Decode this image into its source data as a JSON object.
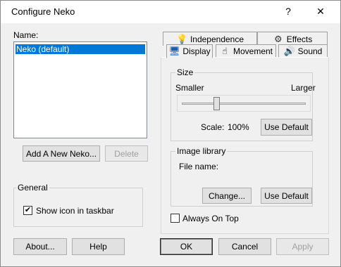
{
  "window": {
    "title": "Configure Neko",
    "help_glyph": "?",
    "close_glyph": "✕"
  },
  "left": {
    "name_label": "Name:",
    "list_items": [
      "Neko (default)"
    ],
    "add_button": "Add A New Neko...",
    "delete_button": "Delete",
    "general_group": "General",
    "show_icon_label": "Show icon in taskbar",
    "show_icon_checked": true,
    "about_button": "About...",
    "help_button": "Help"
  },
  "tabs": {
    "independence": "Independence",
    "effects": "Effects",
    "display": "Display",
    "movement": "Movement",
    "sound": "Sound",
    "icons": {
      "independence": "lightbulb-icon",
      "effects": "effects-icon",
      "display": "display-icon",
      "movement": "movement-icon",
      "sound": "speaker-icon"
    }
  },
  "display_tab": {
    "size_group": "Size",
    "smaller": "Smaller",
    "larger": "Larger",
    "size_slider_fraction": 0.28,
    "scale_label": "Scale:",
    "scale_value": "100%",
    "use_default_1": "Use Default",
    "image_library_group": "Image library",
    "file_name_label": "File name:",
    "change_button": "Change...",
    "use_default_2": "Use Default",
    "always_on_top_label": "Always On Top",
    "always_on_top_checked": false
  },
  "footer": {
    "ok": "OK",
    "cancel": "Cancel",
    "apply": "Apply"
  },
  "colors": {
    "selection": "#0078d7",
    "disabled_text": "#a0a0a0"
  }
}
